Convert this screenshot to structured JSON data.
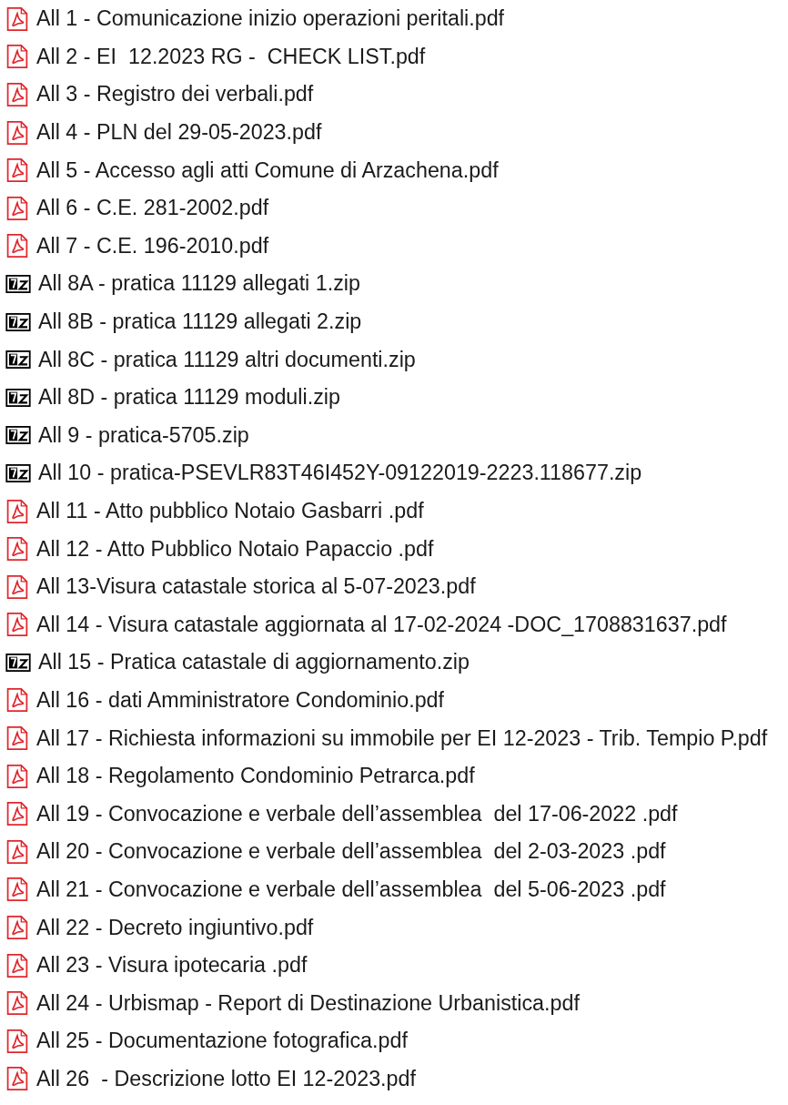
{
  "files": [
    {
      "kind": "pdf",
      "name": "All 1 - Comunicazione inizio operazioni peritali.pdf"
    },
    {
      "kind": "pdf",
      "name": "All 2 - EI  12.2023 RG -  CHECK LIST.pdf"
    },
    {
      "kind": "pdf",
      "name": "All 3 - Registro dei verbali.pdf"
    },
    {
      "kind": "pdf",
      "name": "All 4 - PLN del 29-05-2023.pdf"
    },
    {
      "kind": "pdf",
      "name": "All 5 - Accesso agli atti Comune di Arzachena.pdf"
    },
    {
      "kind": "pdf",
      "name": "All 6 - C.E. 281-2002.pdf"
    },
    {
      "kind": "pdf",
      "name": "All 7 - C.E. 196-2010.pdf"
    },
    {
      "kind": "zip",
      "name": "All 8A - pratica 11129 allegati 1.zip"
    },
    {
      "kind": "zip",
      "name": "All 8B - pratica 11129 allegati 2.zip"
    },
    {
      "kind": "zip",
      "name": "All 8C - pratica 11129 altri documenti.zip"
    },
    {
      "kind": "zip",
      "name": "All 8D - pratica 11129 moduli.zip"
    },
    {
      "kind": "zip",
      "name": "All 9 - pratica-5705.zip"
    },
    {
      "kind": "zip",
      "name": "All 10 - pratica-PSEVLR83T46I452Y-09122019-2223.118677.zip"
    },
    {
      "kind": "pdf",
      "name": "All 11 - Atto pubblico Notaio Gasbarri .pdf"
    },
    {
      "kind": "pdf",
      "name": "All 12 - Atto Pubblico Notaio Papaccio .pdf"
    },
    {
      "kind": "pdf",
      "name": "All 13-Visura catastale storica al 5-07-2023.pdf"
    },
    {
      "kind": "pdf",
      "name": "All 14 - Visura catastale aggiornata al 17-02-2024 -DOC_1708831637.pdf"
    },
    {
      "kind": "zip",
      "name": "All 15 - Pratica catastale di aggiornamento.zip"
    },
    {
      "kind": "pdf",
      "name": "All 16 - dati Amministratore Condominio.pdf"
    },
    {
      "kind": "pdf",
      "name": "All 17 - Richiesta informazioni su immobile per EI 12-2023 - Trib. Tempio P.pdf"
    },
    {
      "kind": "pdf",
      "name": "All 18 - Regolamento Condominio Petrarca.pdf"
    },
    {
      "kind": "pdf",
      "name": "All 19 - Convocazione e verbale dell’assemblea  del 17-06-2022 .pdf"
    },
    {
      "kind": "pdf",
      "name": "All 20 - Convocazione e verbale dell’assemblea  del 2-03-2023 .pdf"
    },
    {
      "kind": "pdf",
      "name": "All 21 - Convocazione e verbale dell’assemblea  del 5-06-2023 .pdf"
    },
    {
      "kind": "pdf",
      "name": "All 22 - Decreto ingiuntivo.pdf"
    },
    {
      "kind": "pdf",
      "name": "All 23 - Visura ipotecaria .pdf"
    },
    {
      "kind": "pdf",
      "name": "All 24 - Urbismap - Report di Destinazione Urbanistica.pdf"
    },
    {
      "kind": "pdf",
      "name": "All 25 - Documentazione fotografica.pdf"
    },
    {
      "kind": "pdf",
      "name": "All 26  - Descrizione lotto EI 12-2023.pdf"
    }
  ]
}
